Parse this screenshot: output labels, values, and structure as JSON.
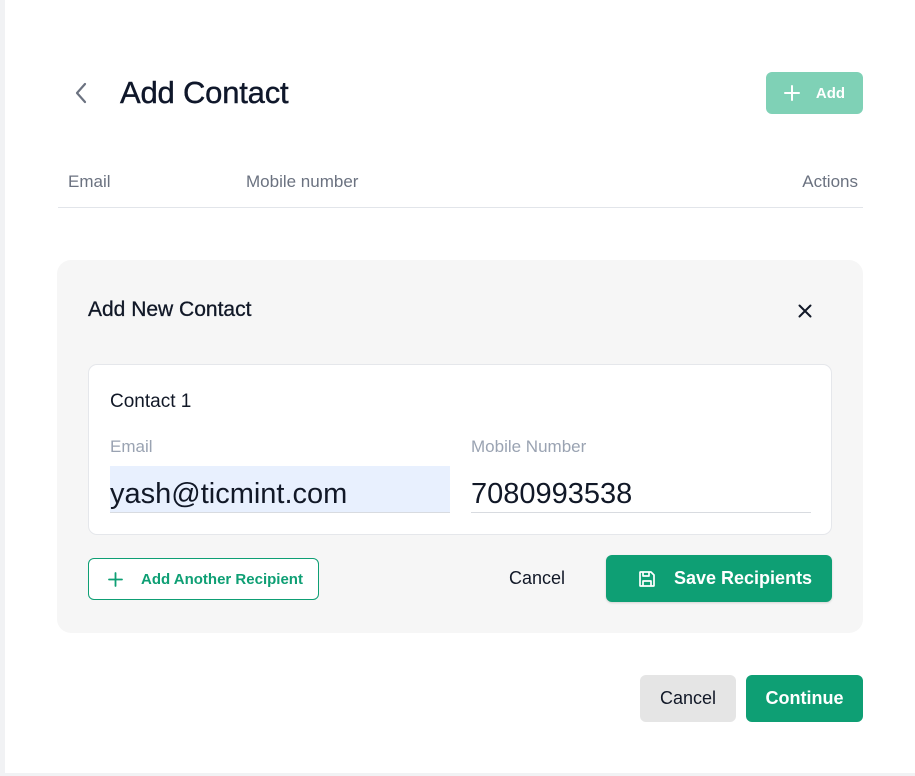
{
  "header": {
    "back_icon": "chevron-left-icon",
    "title": "Add Contact",
    "add_button": {
      "label": "Add",
      "icon": "plus-icon",
      "enabled": false,
      "color": "#7fd1b6"
    }
  },
  "table": {
    "columns": [
      "Email",
      "Mobile number",
      "Actions"
    ]
  },
  "dialog": {
    "title": "Add New Contact",
    "close_icon": "close-icon",
    "contacts": [
      {
        "title": "Contact 1",
        "email_label": "Email",
        "email_value": "yash@ticmint.com",
        "mobile_label": "Mobile Number",
        "mobile_value": "7080993538"
      }
    ],
    "add_another_label": "Add Another Recipient",
    "cancel_label": "Cancel",
    "save_label": "Save Recipients",
    "save_icon": "save-icon"
  },
  "footer": {
    "cancel_label": "Cancel",
    "continue_label": "Continue"
  },
  "colors": {
    "accent": "#0e9f74",
    "accent_disabled": "#7fd1b6",
    "panel_bg": "#f6f6f6",
    "autofill_bg": "#e8f0fe"
  }
}
